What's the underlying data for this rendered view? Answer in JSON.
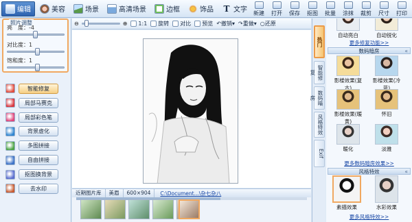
{
  "modes": [
    {
      "label": "编辑",
      "icon": "edit-icon"
    },
    {
      "label": "美容",
      "icon": "face-icon"
    },
    {
      "label": "场景",
      "icon": "scene-icon"
    },
    {
      "label": "高清场景",
      "icon": "hd-scene-icon"
    },
    {
      "label": "边框",
      "icon": "frame-icon"
    },
    {
      "label": "饰品",
      "icon": "decoration-icon"
    },
    {
      "label": "文字",
      "icon": "text-icon"
    }
  ],
  "toolbar": {
    "new": "新建",
    "open": "打开",
    "save": "保存",
    "capture": "抠图",
    "batch": "批量",
    "graffiti": "涂抹",
    "crop": "裁剪",
    "size": "尺寸",
    "print": "打印"
  },
  "adjust": {
    "title": "照片调整",
    "brightness_label": "亮　度：",
    "brightness_value": "-4",
    "brightness_level": 0.48,
    "contrast_label": "对比度：",
    "contrast_value": "1",
    "contrast_level": 0.51,
    "saturation_label": "饱和度：",
    "saturation_value": "1",
    "saturation_level": 0.51
  },
  "functions": [
    {
      "label": "智能修复",
      "icon": "smart-repair-icon",
      "color": "#e24b3b"
    },
    {
      "label": "局部马赛克",
      "icon": "mosaic-icon",
      "color": "#d9363e"
    },
    {
      "label": "局部彩色笔",
      "icon": "color-pen-icon",
      "color": "#e0457b"
    },
    {
      "label": "背景虚化",
      "icon": "blur-icon",
      "color": "#2f86d1"
    },
    {
      "label": "多图拼接",
      "icon": "multi-stitch-icon",
      "color": "#4ba343"
    },
    {
      "label": "自由拼接",
      "icon": "free-stitch-icon",
      "color": "#3c72c7"
    },
    {
      "label": "抠图换背景",
      "icon": "cutout-icon",
      "color": "#5a6ed0"
    },
    {
      "label": "去水印",
      "icon": "watermark-icon",
      "color": "#c85a2f"
    }
  ],
  "canvas": {
    "zoom_ratio": "1:1",
    "rotate": "旋转",
    "compare": "对比",
    "preview": "预览",
    "undo": "撤销",
    "redo": "重做",
    "restore": "还原"
  },
  "bottom": {
    "recent_tab": "近期图片库",
    "beauty_tab": "美眉",
    "resolution": "600×904",
    "path": "C:\\Document...\\杂七杂八"
  },
  "side_tabs": [
    "热门",
    "智能修复",
    "数码暗房",
    "风格特效",
    "Exif"
  ],
  "effects": {
    "top_items": [
      "自动亮白",
      "自动锐化"
    ],
    "more_repair": "更多修复功能>>",
    "darkroom_title": "数码暗房",
    "darkroom_items": [
      "影楼效果(复古)",
      "影楼效果(冷蓝)",
      "影楼效果(暖黄)",
      "怀旧",
      "暖化",
      "淡雅"
    ],
    "more_darkroom": "更多数码暗房效果>>",
    "style_title": "风格特效",
    "style_items": [
      "素描效果",
      "水彩效果"
    ],
    "more_style": "更多风格特效>>"
  }
}
